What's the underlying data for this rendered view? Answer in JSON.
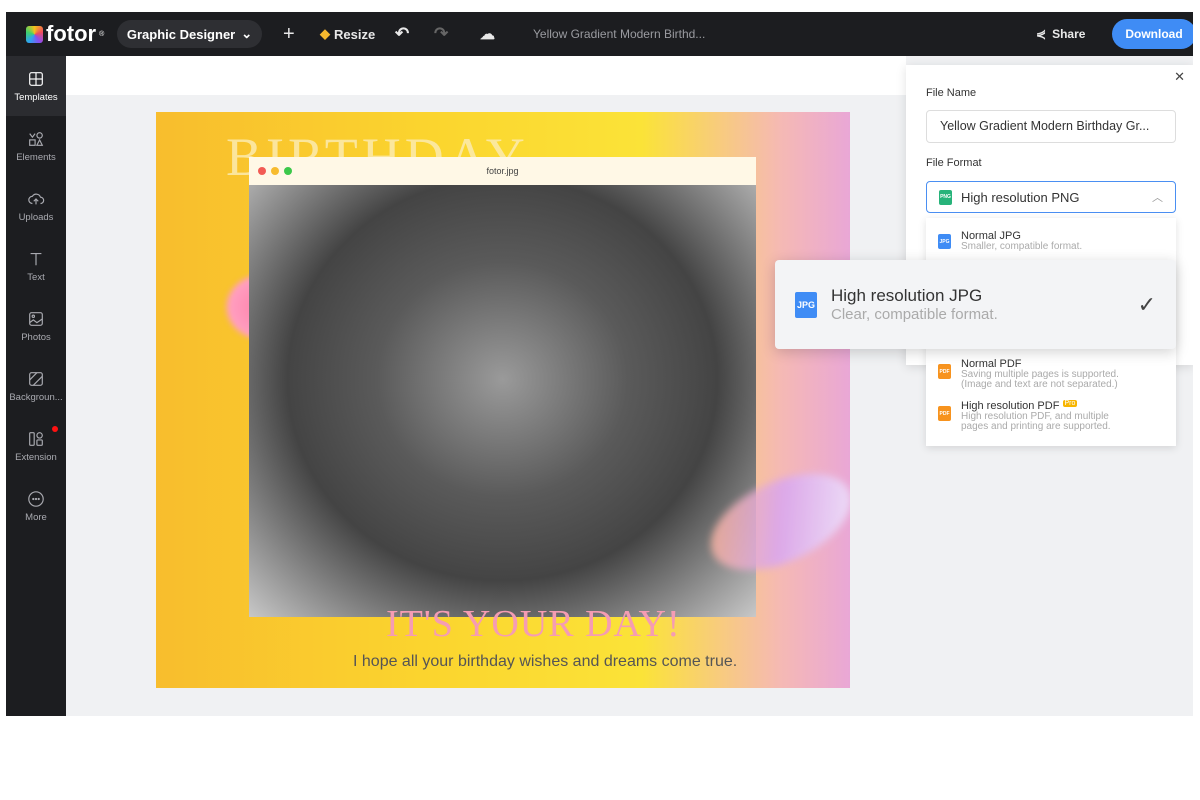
{
  "topbar": {
    "logo": "fotor",
    "mode": "Graphic Designer",
    "resize": "Resize",
    "doc_title": "Yellow Gradient Modern Birthd...",
    "share": "Share",
    "download": "Download"
  },
  "sidebar": {
    "items": [
      {
        "label": "Templates",
        "icon": "templates-icon"
      },
      {
        "label": "Elements",
        "icon": "elements-icon"
      },
      {
        "label": "Uploads",
        "icon": "upload-cloud-icon"
      },
      {
        "label": "Text",
        "icon": "text-icon"
      },
      {
        "label": "Photos",
        "icon": "photo-icon"
      },
      {
        "label": "Backgroun...",
        "icon": "background-icon"
      },
      {
        "label": "Extension",
        "icon": "extension-icon"
      },
      {
        "label": "More",
        "icon": "more-icon"
      }
    ]
  },
  "design": {
    "headline": "BIRTHDAY",
    "browser_title": "fotor.jpg",
    "tagline": "IT'S YOUR DAY!",
    "message": "I hope all your birthday wishes and dreams come true."
  },
  "panel": {
    "file_name_label": "File Name",
    "file_name": "Yellow Gradient Modern Birthday Gr...",
    "file_format_label": "File Format",
    "selected_format": "High resolution PNG",
    "options": [
      {
        "title": "Normal JPG",
        "desc": "Smaller, compatible format.",
        "icon": "JPG"
      },
      {
        "title": "High resolution JPG",
        "desc": "Clear, compatible format.",
        "icon": "JPG"
      },
      {
        "title": "Normal PDF",
        "desc1": "Saving multiple pages is supported.",
        "desc2": "(Image and text are not separated.)",
        "icon": "PDF"
      },
      {
        "title": "High resolution PDF",
        "badge": "Pro",
        "desc1": "High resolution PDF, and multiple",
        "desc2": "pages and printing are supported.",
        "icon": "PDF"
      }
    ],
    "png_icon": "PNG"
  },
  "colors": {
    "accent": "#3f8cf5",
    "topbar": "#1c1d20",
    "jpg": "#3f8cf5",
    "pdf": "#f7931e",
    "png": "#27b37a"
  }
}
